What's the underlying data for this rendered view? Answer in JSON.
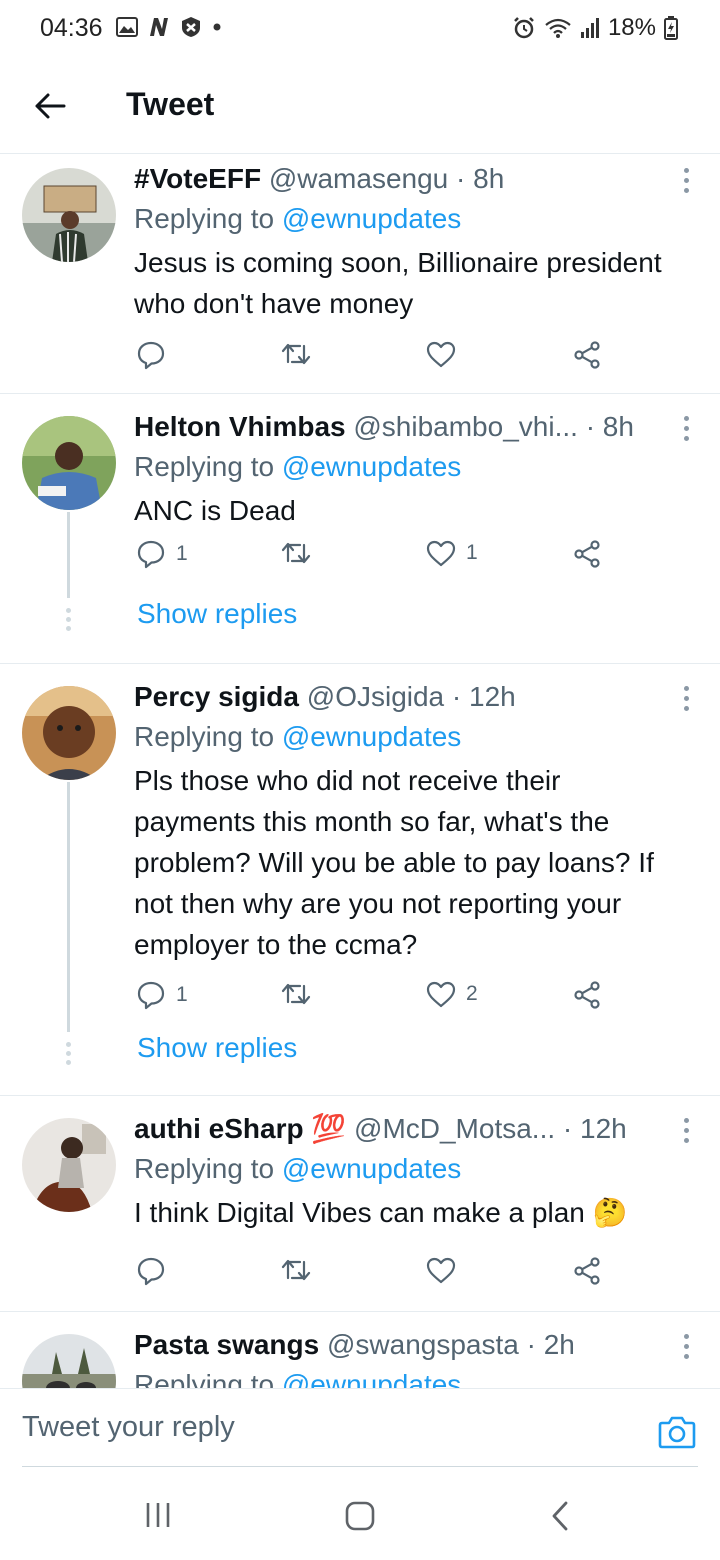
{
  "status_bar": {
    "time": "04:36",
    "battery": "18%",
    "left_icons": [
      "image-icon",
      "n-icon",
      "blocked-icon",
      "dot-icon"
    ],
    "right_icons": [
      "alarm-icon",
      "wifi-icon",
      "signal-icon",
      "battery-icon"
    ]
  },
  "header": {
    "title": "Tweet"
  },
  "tweets": [
    {
      "name": "#VoteEFF",
      "handle": "@wamasengu · 8h",
      "replying_prefix": "Replying to ",
      "replying_to": "@ewnupdates",
      "text": "Jesus is coming soon, Billionaire president who don't have money",
      "reply_count": "",
      "like_count": ""
    },
    {
      "name": "Helton Vhimbas",
      "handle": "@shibambo_vhi... · 8h",
      "replying_prefix": "Replying to ",
      "replying_to": "@ewnupdates",
      "text": "ANC is Dead",
      "reply_count": "1",
      "like_count": "1",
      "show_replies": "Show replies"
    },
    {
      "name": "Percy sigida",
      "handle": "@OJsigida · 12h",
      "replying_prefix": "Replying to ",
      "replying_to": "@ewnupdates",
      "text": "Pls those who did not receive their payments this month so far, what's the problem? Will you be able to pay loans? If not then why are you not reporting your employer to the ccma?",
      "reply_count": "1",
      "like_count": "2",
      "show_replies": "Show replies"
    },
    {
      "name": "authi eSharp 💯",
      "handle": "@McD_Motsa... · 12h",
      "replying_prefix": "Replying to ",
      "replying_to": "@ewnupdates",
      "text": "I think Digital Vibes can make a plan 🤔",
      "reply_count": "",
      "like_count": ""
    },
    {
      "name": "Pasta swangs",
      "handle": "@swangspasta · 2h",
      "replying_prefix": "Replying to ",
      "replying_to": "@ewnupdates"
    }
  ],
  "reply_bar": {
    "placeholder": "Tweet your reply"
  },
  "colors": {
    "accent": "#1d9bf0",
    "text": "#0f1419",
    "secondary": "#536471",
    "divider": "#e6ecf0"
  }
}
